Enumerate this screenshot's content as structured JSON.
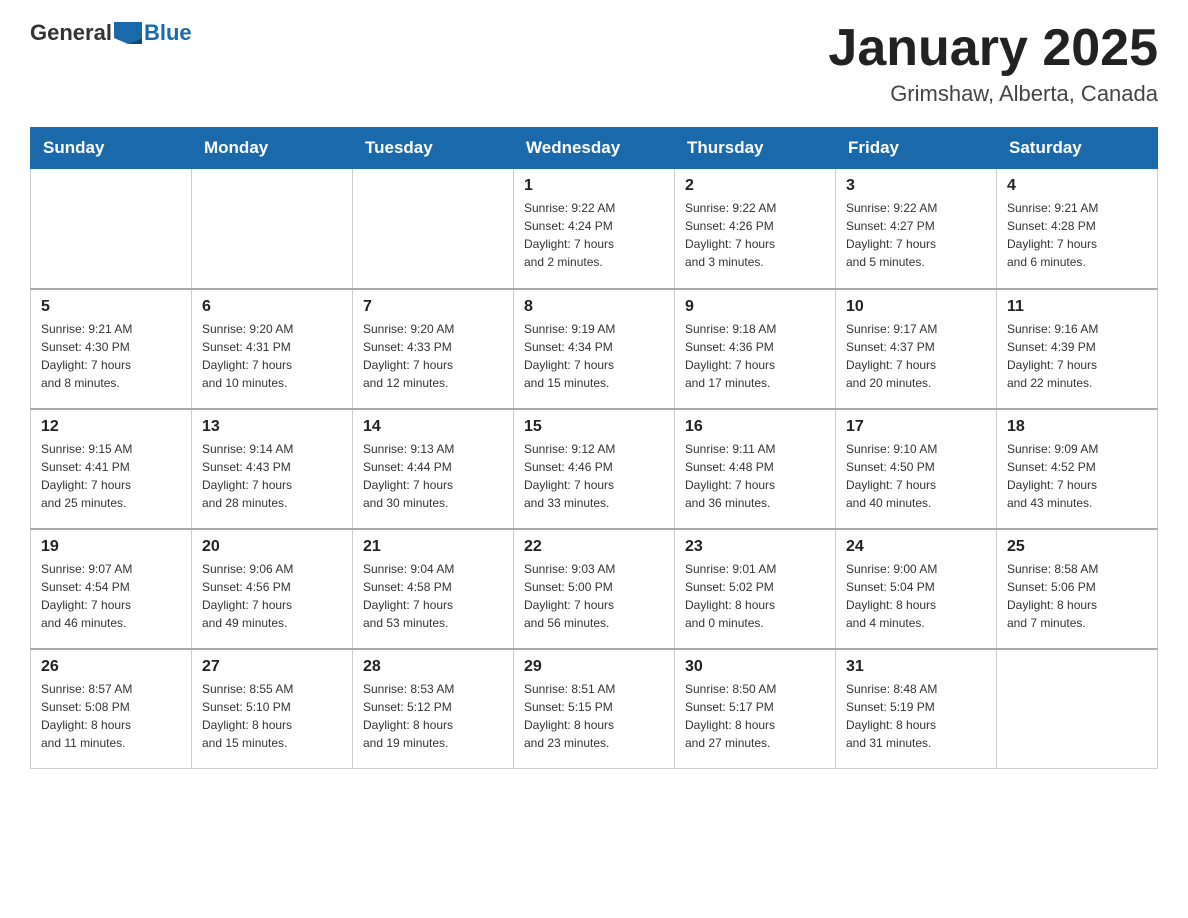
{
  "header": {
    "logo_text_general": "General",
    "logo_text_blue": "Blue",
    "month_title": "January 2025",
    "location": "Grimshaw, Alberta, Canada"
  },
  "days_of_week": [
    "Sunday",
    "Monday",
    "Tuesday",
    "Wednesday",
    "Thursday",
    "Friday",
    "Saturday"
  ],
  "weeks": [
    [
      {
        "day": "",
        "info": ""
      },
      {
        "day": "",
        "info": ""
      },
      {
        "day": "",
        "info": ""
      },
      {
        "day": "1",
        "info": "Sunrise: 9:22 AM\nSunset: 4:24 PM\nDaylight: 7 hours\nand 2 minutes."
      },
      {
        "day": "2",
        "info": "Sunrise: 9:22 AM\nSunset: 4:26 PM\nDaylight: 7 hours\nand 3 minutes."
      },
      {
        "day": "3",
        "info": "Sunrise: 9:22 AM\nSunset: 4:27 PM\nDaylight: 7 hours\nand 5 minutes."
      },
      {
        "day": "4",
        "info": "Sunrise: 9:21 AM\nSunset: 4:28 PM\nDaylight: 7 hours\nand 6 minutes."
      }
    ],
    [
      {
        "day": "5",
        "info": "Sunrise: 9:21 AM\nSunset: 4:30 PM\nDaylight: 7 hours\nand 8 minutes."
      },
      {
        "day": "6",
        "info": "Sunrise: 9:20 AM\nSunset: 4:31 PM\nDaylight: 7 hours\nand 10 minutes."
      },
      {
        "day": "7",
        "info": "Sunrise: 9:20 AM\nSunset: 4:33 PM\nDaylight: 7 hours\nand 12 minutes."
      },
      {
        "day": "8",
        "info": "Sunrise: 9:19 AM\nSunset: 4:34 PM\nDaylight: 7 hours\nand 15 minutes."
      },
      {
        "day": "9",
        "info": "Sunrise: 9:18 AM\nSunset: 4:36 PM\nDaylight: 7 hours\nand 17 minutes."
      },
      {
        "day": "10",
        "info": "Sunrise: 9:17 AM\nSunset: 4:37 PM\nDaylight: 7 hours\nand 20 minutes."
      },
      {
        "day": "11",
        "info": "Sunrise: 9:16 AM\nSunset: 4:39 PM\nDaylight: 7 hours\nand 22 minutes."
      }
    ],
    [
      {
        "day": "12",
        "info": "Sunrise: 9:15 AM\nSunset: 4:41 PM\nDaylight: 7 hours\nand 25 minutes."
      },
      {
        "day": "13",
        "info": "Sunrise: 9:14 AM\nSunset: 4:43 PM\nDaylight: 7 hours\nand 28 minutes."
      },
      {
        "day": "14",
        "info": "Sunrise: 9:13 AM\nSunset: 4:44 PM\nDaylight: 7 hours\nand 30 minutes."
      },
      {
        "day": "15",
        "info": "Sunrise: 9:12 AM\nSunset: 4:46 PM\nDaylight: 7 hours\nand 33 minutes."
      },
      {
        "day": "16",
        "info": "Sunrise: 9:11 AM\nSunset: 4:48 PM\nDaylight: 7 hours\nand 36 minutes."
      },
      {
        "day": "17",
        "info": "Sunrise: 9:10 AM\nSunset: 4:50 PM\nDaylight: 7 hours\nand 40 minutes."
      },
      {
        "day": "18",
        "info": "Sunrise: 9:09 AM\nSunset: 4:52 PM\nDaylight: 7 hours\nand 43 minutes."
      }
    ],
    [
      {
        "day": "19",
        "info": "Sunrise: 9:07 AM\nSunset: 4:54 PM\nDaylight: 7 hours\nand 46 minutes."
      },
      {
        "day": "20",
        "info": "Sunrise: 9:06 AM\nSunset: 4:56 PM\nDaylight: 7 hours\nand 49 minutes."
      },
      {
        "day": "21",
        "info": "Sunrise: 9:04 AM\nSunset: 4:58 PM\nDaylight: 7 hours\nand 53 minutes."
      },
      {
        "day": "22",
        "info": "Sunrise: 9:03 AM\nSunset: 5:00 PM\nDaylight: 7 hours\nand 56 minutes."
      },
      {
        "day": "23",
        "info": "Sunrise: 9:01 AM\nSunset: 5:02 PM\nDaylight: 8 hours\nand 0 minutes."
      },
      {
        "day": "24",
        "info": "Sunrise: 9:00 AM\nSunset: 5:04 PM\nDaylight: 8 hours\nand 4 minutes."
      },
      {
        "day": "25",
        "info": "Sunrise: 8:58 AM\nSunset: 5:06 PM\nDaylight: 8 hours\nand 7 minutes."
      }
    ],
    [
      {
        "day": "26",
        "info": "Sunrise: 8:57 AM\nSunset: 5:08 PM\nDaylight: 8 hours\nand 11 minutes."
      },
      {
        "day": "27",
        "info": "Sunrise: 8:55 AM\nSunset: 5:10 PM\nDaylight: 8 hours\nand 15 minutes."
      },
      {
        "day": "28",
        "info": "Sunrise: 8:53 AM\nSunset: 5:12 PM\nDaylight: 8 hours\nand 19 minutes."
      },
      {
        "day": "29",
        "info": "Sunrise: 8:51 AM\nSunset: 5:15 PM\nDaylight: 8 hours\nand 23 minutes."
      },
      {
        "day": "30",
        "info": "Sunrise: 8:50 AM\nSunset: 5:17 PM\nDaylight: 8 hours\nand 27 minutes."
      },
      {
        "day": "31",
        "info": "Sunrise: 8:48 AM\nSunset: 5:19 PM\nDaylight: 8 hours\nand 31 minutes."
      },
      {
        "day": "",
        "info": ""
      }
    ]
  ]
}
